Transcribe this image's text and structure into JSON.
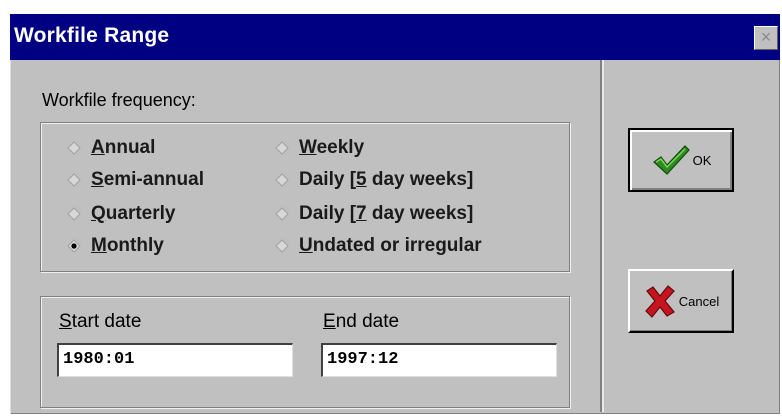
{
  "window": {
    "title": "Workfile Range",
    "close_glyph": "×"
  },
  "frequency": {
    "label": "Workfile frequency:",
    "options": [
      {
        "pre": "",
        "key": "A",
        "post": "nnual",
        "selected": false
      },
      {
        "pre": "",
        "key": "S",
        "post": "emi-annual",
        "selected": false
      },
      {
        "pre": "",
        "key": "Q",
        "post": "uarterly",
        "selected": false
      },
      {
        "pre": "",
        "key": "M",
        "post": "onthly",
        "selected": true
      },
      {
        "pre": "",
        "key": "W",
        "post": "eekly",
        "selected": false
      },
      {
        "pre": "Daily [",
        "key": "5",
        "post": " day weeks]",
        "selected": false
      },
      {
        "pre": "Daily [",
        "key": "7",
        "post": " day weeks]",
        "selected": false
      },
      {
        "pre": "",
        "key": "U",
        "post": "ndated or irregular",
        "selected": false
      }
    ]
  },
  "dates": {
    "start_key": "S",
    "start_rest": "tart date",
    "start_value": "1980:01",
    "end_key": "E",
    "end_rest": "nd date",
    "end_value": "1997:12"
  },
  "buttons": {
    "ok_label": "OK",
    "cancel_label": "Cancel"
  },
  "icons": {
    "ok": "checkmark-icon",
    "cancel": "x-mark-icon",
    "ok_color": "#2e8b1e",
    "cancel_color": "#c8141e"
  }
}
